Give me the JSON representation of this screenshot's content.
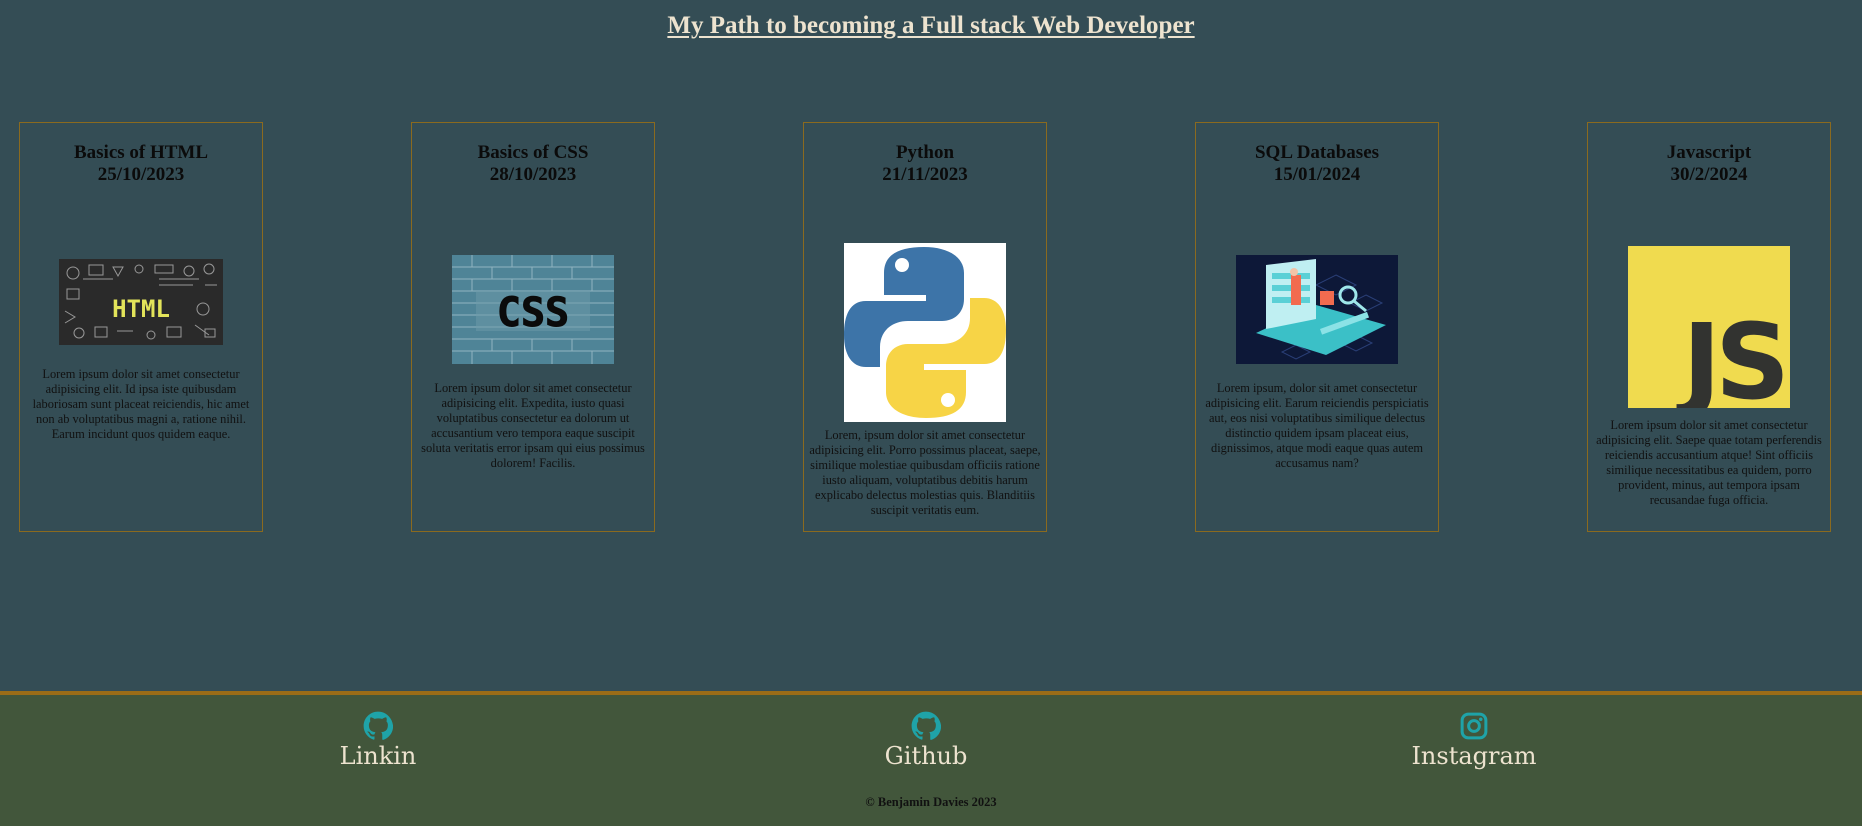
{
  "page": {
    "title": "My Path to becoming a Full stack Web Developer"
  },
  "cards": [
    {
      "title": "Basics of HTML",
      "date": "25/10/2023",
      "image_text": "HTML",
      "text": "Lorem ipsum dolor sit amet consectetur adipisicing elit. Id ipsa iste quibusdam laboriosam sunt placeat reiciendis, hic amet non ab voluptatibus magni a, ratione nihil. Earum incidunt quos quidem eaque."
    },
    {
      "title": "Basics of CSS",
      "date": "28/10/2023",
      "image_text": "CSS",
      "text": "Lorem ipsum dolor sit amet consectetur adipisicing elit. Expedita, iusto quasi voluptatibus consectetur ea dolorum ut accusantium vero tempora eaque suscipit soluta veritatis error ipsam qui eius possimus dolorem! Facilis."
    },
    {
      "title": "Python",
      "date": "21/11/2023",
      "text": "Lorem, ipsum dolor sit amet consectetur adipisicing elit. Porro possimus placeat, saepe, similique molestiae quibusdam officiis ratione iusto aliquam, voluptatibus debitis harum explicabo delectus molestias quis. Blanditiis suscipit veritatis eum."
    },
    {
      "title": "SQL Databases",
      "date": "15/01/2024",
      "text": "Lorem ipsum, dolor sit amet consectetur adipisicing elit. Earum reiciendis perspiciatis aut, eos nisi voluptatibus similique delectus distinctio quidem ipsam placeat eius, dignissimos, atque modi eaque quas autem accusamus nam?"
    },
    {
      "title": "Javascript",
      "date": "30/2/2024",
      "image_text": "JS",
      "text": "Lorem ipsum dolor sit amet consectetur adipisicing elit. Saepe quae totam perferendis reiciendis accusantium atque! Sint officiis similique necessitatibus ea quidem, porro provident, minus, aut tempora ipsam recusandae fuga officia."
    }
  ],
  "footer": {
    "links": [
      {
        "label": "Linkin",
        "icon": "github-icon"
      },
      {
        "label": "Github",
        "icon": "github-icon"
      },
      {
        "label": "Instagram",
        "icon": "instagram-icon"
      }
    ],
    "copyright": "© Benjamin Davies 2023"
  },
  "colors": {
    "background": "#344d55",
    "footer": "#42563b",
    "accent": "#9a6c17",
    "icon": "#1fa3a8"
  }
}
